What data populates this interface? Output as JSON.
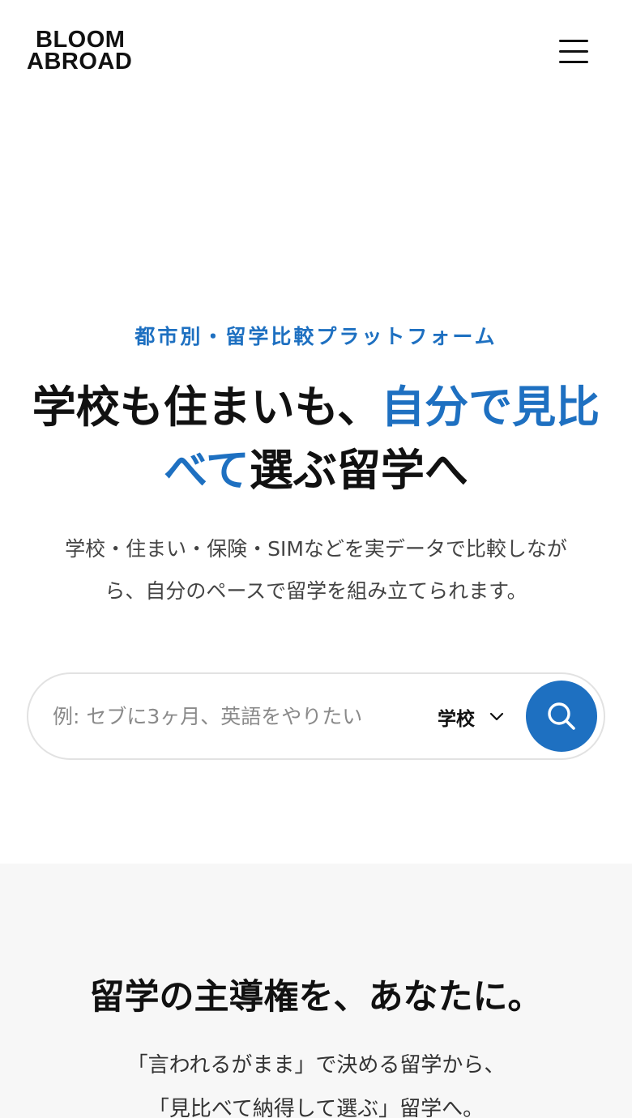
{
  "header": {
    "logo_line1": "BLOOM",
    "logo_line2": "ABROAD",
    "menu_icon": "hamburger-menu-icon"
  },
  "hero": {
    "eyebrow": "都市別・留学比較プラットフォーム",
    "headline_line1_part1": "学校も住まいも、",
    "headline_line1_part2": "自分で見比",
    "headline_line2_part1": "べて",
    "headline_line2_part2": "選ぶ留学へ",
    "lead_line1": "学校・住まい・保険・SIMなどを実データで比較しなが",
    "lead_line2": "ら、自分のペースで留学を組み立てられます。"
  },
  "search": {
    "placeholder": "例: セブに3ヶ月、英語をやりたい",
    "value": "",
    "category_selected": "学校",
    "search_icon": "search-icon",
    "chevron_icon": "chevron-down-icon"
  },
  "section2": {
    "title": "留学の主導権を、あなたに。",
    "text_line1": "「言われるがまま」で決める留学から、",
    "text_line2": "「見比べて納得して選ぶ」留学へ。"
  },
  "colors": {
    "accent": "#1e70c1",
    "text": "#111111",
    "section_bg": "#f7f7f7"
  }
}
